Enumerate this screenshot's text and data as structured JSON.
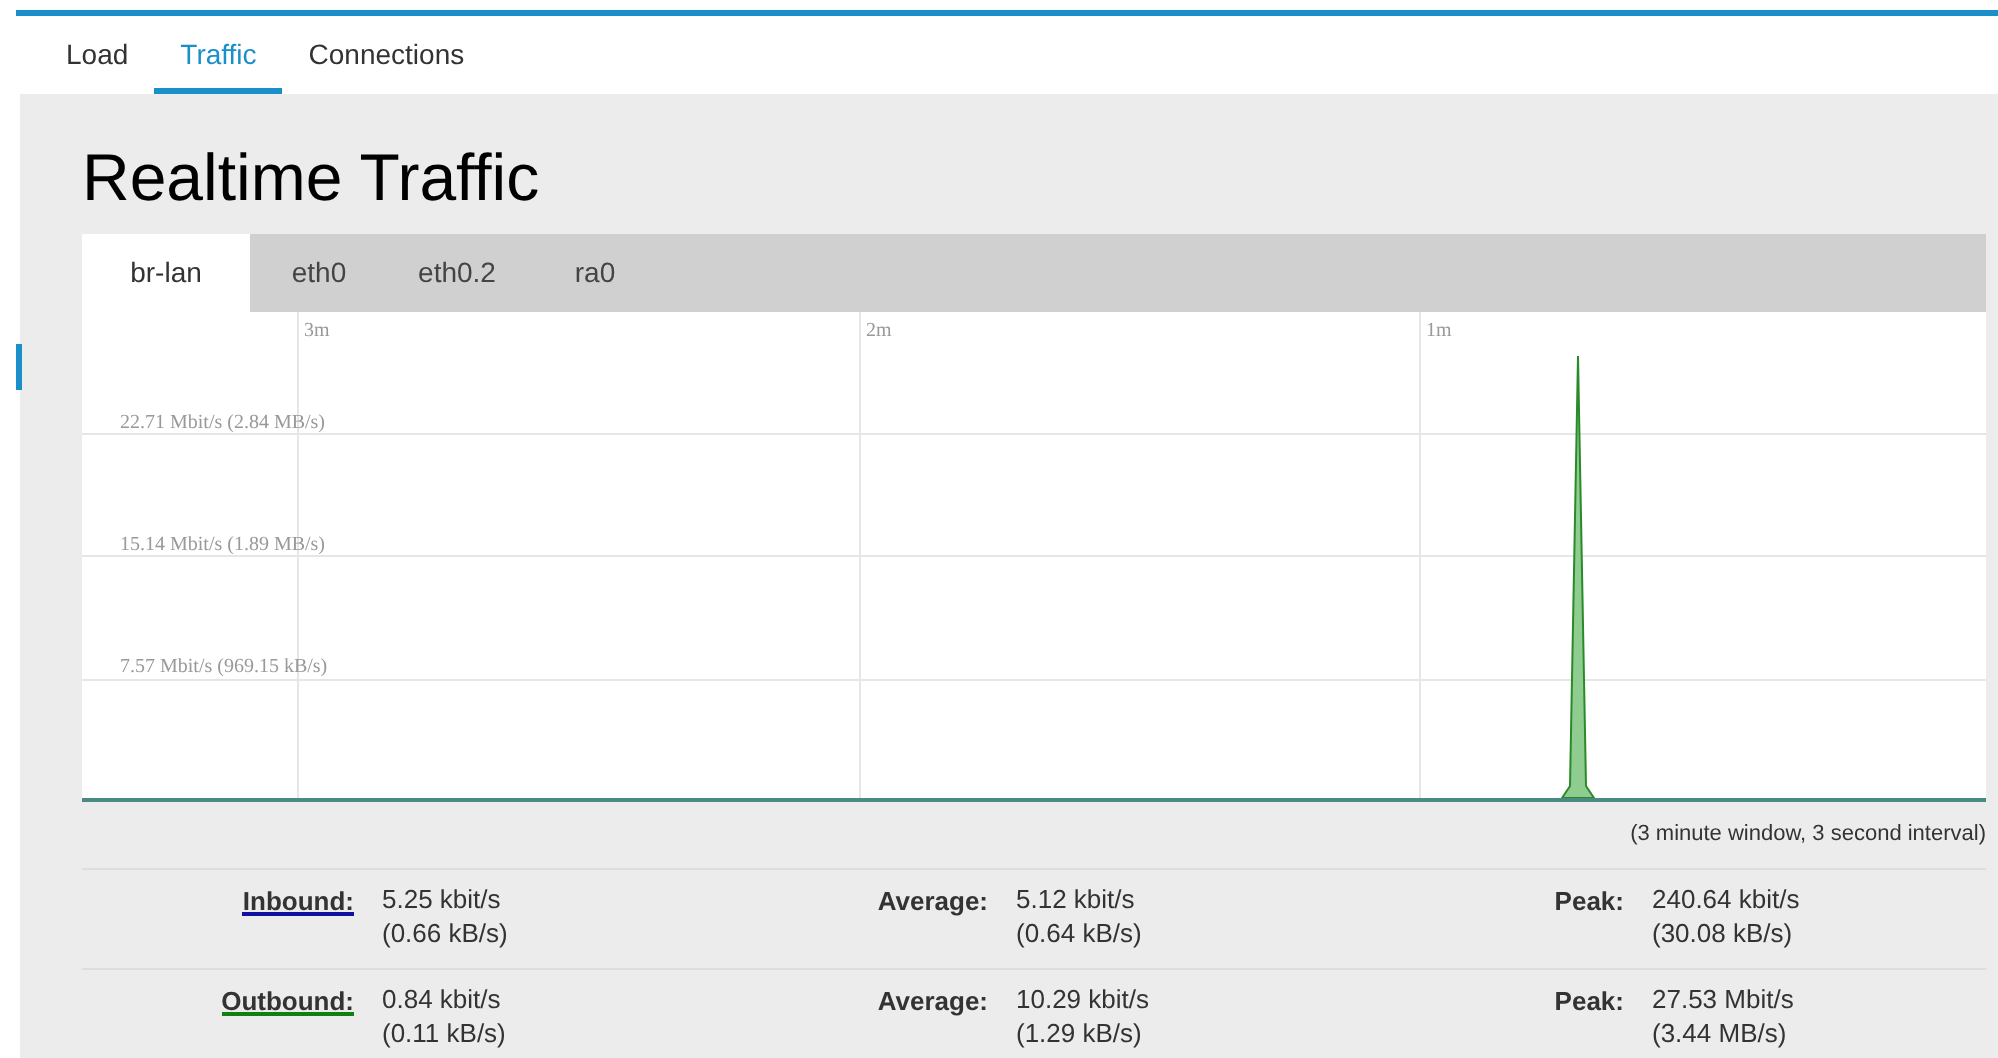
{
  "nav_tabs": [
    {
      "label": "Load",
      "selected": false
    },
    {
      "label": "Traffic",
      "selected": true
    },
    {
      "label": "Connections",
      "selected": false
    }
  ],
  "title": "Realtime Traffic",
  "interface_tabs": [
    {
      "label": "br-lan",
      "selected": true
    },
    {
      "label": "eth0",
      "selected": false
    },
    {
      "label": "eth0.2",
      "selected": false
    },
    {
      "label": "ra0",
      "selected": false
    }
  ],
  "graph": {
    "time_labels": [
      "3m",
      "2m",
      "1m"
    ],
    "rate_labels": [
      "22.71 Mbit/s (2.84 MB/s)",
      "15.14 Mbit/s (1.89 MB/s)",
      "7.57 Mbit/s (969.15 kB/s)"
    ],
    "caption": "(3 minute window, 3 second interval)"
  },
  "stats": [
    {
      "kind": "inbound",
      "label": "Inbound:",
      "current": [
        "5.25 kbit/s",
        "(0.66 kB/s)"
      ],
      "average_label": "Average:",
      "average": [
        "5.12 kbit/s",
        "(0.64 kB/s)"
      ],
      "peak_label": "Peak:",
      "peak": [
        "240.64 kbit/s",
        "(30.08 kB/s)"
      ]
    },
    {
      "kind": "outbound",
      "label": "Outbound:",
      "current": [
        "0.84 kbit/s",
        "(0.11 kB/s)"
      ],
      "average_label": "Average:",
      "average": [
        "10.29 kbit/s",
        "(1.29 kB/s)"
      ],
      "peak_label": "Peak:",
      "peak": [
        "27.53 Mbit/s",
        "(3.44 MB/s)"
      ]
    }
  ]
}
